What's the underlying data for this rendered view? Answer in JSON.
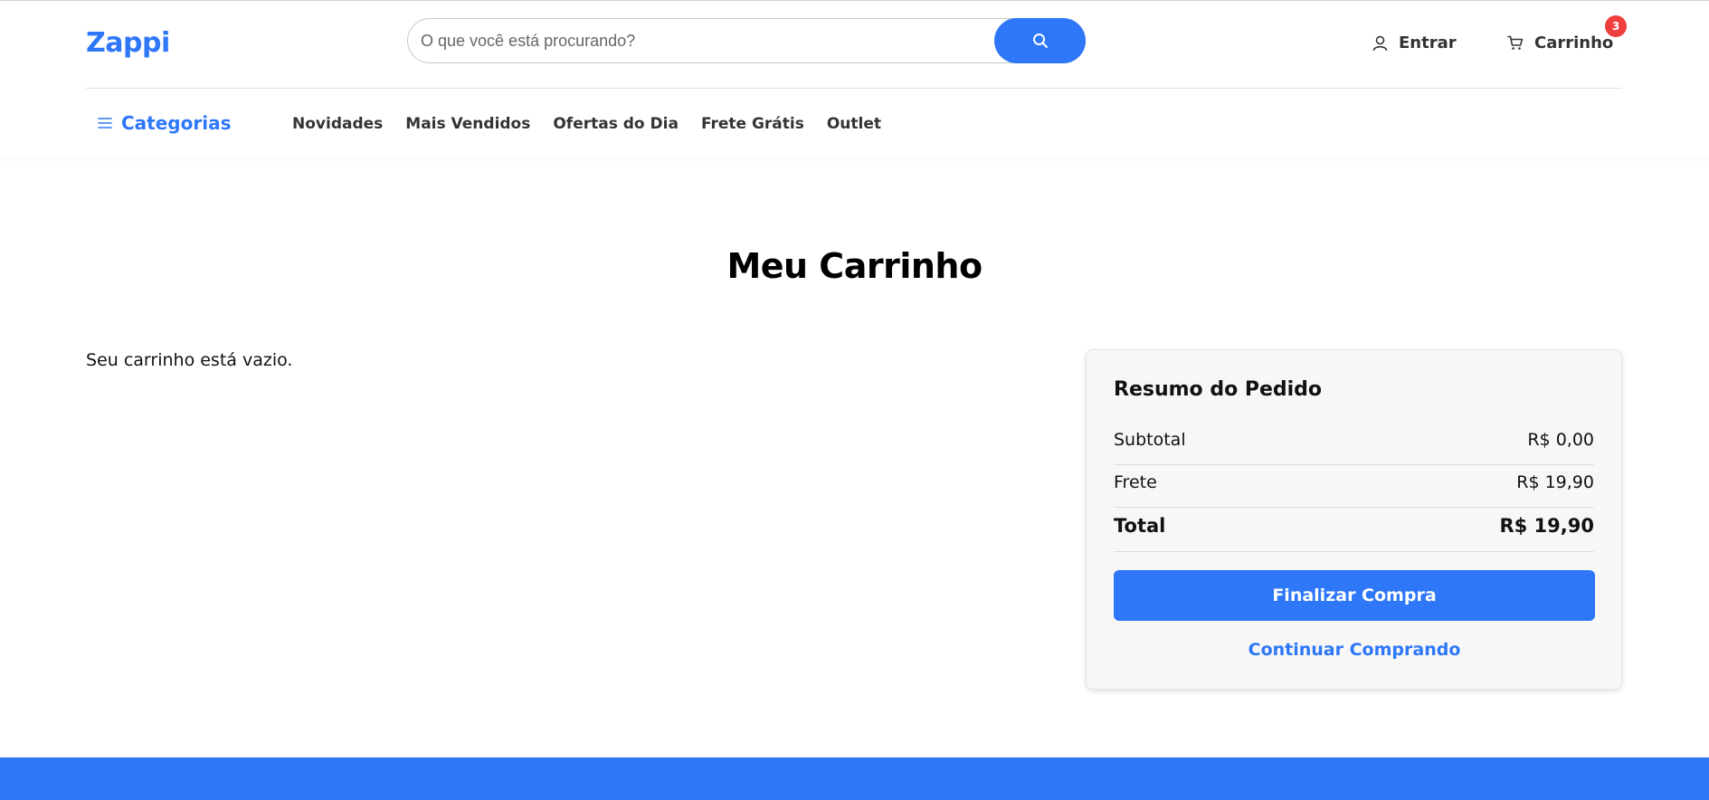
{
  "header": {
    "logo": "Zappi",
    "search": {
      "placeholder": "O que você está procurando?",
      "value": ""
    },
    "account_label": "Entrar",
    "cart_label": "Carrinho",
    "cart_count": "3"
  },
  "nav": {
    "categories_label": "Categorias",
    "links": [
      "Novidades",
      "Mais Vendidos",
      "Ofertas do Dia",
      "Frete Grátis",
      "Outlet"
    ]
  },
  "main": {
    "title": "Meu Carrinho",
    "empty_message": "Seu carrinho está vazio."
  },
  "summary": {
    "title": "Resumo do Pedido",
    "subtotal_label": "Subtotal",
    "subtotal_value": "R$ 0,00",
    "shipping_label": "Frete",
    "shipping_value": "R$ 19,90",
    "total_label": "Total",
    "total_value": "R$ 19,90",
    "checkout_label": "Finalizar Compra",
    "continue_label": "Continuar Comprando"
  },
  "colors": {
    "accent": "#2d77f8",
    "badge": "#ef3e3e"
  },
  "icons": [
    "search-icon",
    "user-icon",
    "cart-icon",
    "menu-icon"
  ]
}
